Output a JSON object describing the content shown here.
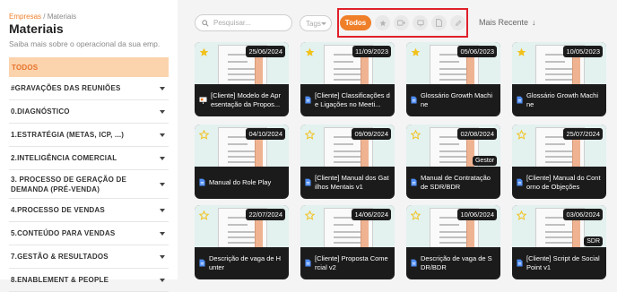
{
  "breadcrumb": {
    "parent": "Empresas",
    "separator": " / ",
    "current": "Materiais"
  },
  "page": {
    "title": "Materiais",
    "subtitle": "Saiba mais sobre o operacional da sua emp."
  },
  "sidebar": {
    "items": [
      {
        "label": "TODOS",
        "active": true
      },
      {
        "label": "#GRAVAÇÕES DAS REUNIÕES"
      },
      {
        "label": "0.DIAGNÓSTICO"
      },
      {
        "label": "1.ESTRATÉGIA (METAS, ICP, ...)"
      },
      {
        "label": "2.INTELIGÊNCIA COMERCIAL"
      },
      {
        "label": "3. PROCESSO DE GERAÇÃO DE DEMANDA (PRÉ-VENDA)"
      },
      {
        "label": "4.PROCESSO DE VENDAS"
      },
      {
        "label": "5.CONTEÚDO PARA VENDAS"
      },
      {
        "label": "7.GESTÃO & RESULTADOS"
      },
      {
        "label": "8.ENABLEMENT & PEOPLE"
      }
    ]
  },
  "toolbar": {
    "search_placeholder": "Pesquisar...",
    "tags_label": "Tags",
    "filter_all_label": "Todos",
    "sort_label": "Mais Recente",
    "highlight_color": "#e0202a",
    "accent_color": "#f07f2a"
  },
  "cards": [
    {
      "title": "[Cliente] Modelo de Apresentação da Propos...",
      "date": "25/06/2024",
      "starred": true,
      "icon": "presentation-icon"
    },
    {
      "title": "[Cliente] Classificações de Ligações no Meeti...",
      "date": "11/09/2023",
      "starred": true,
      "icon": "doc-icon"
    },
    {
      "title": "Glossário Growth Machine",
      "date": "05/06/2023",
      "starred": true,
      "icon": "doc-icon"
    },
    {
      "title": "Glossário Growth Machine",
      "date": "10/05/2023",
      "starred": true,
      "icon": "doc-icon"
    },
    {
      "title": "Manual do Role Play",
      "date": "04/10/2024",
      "starred": false,
      "icon": "doc-icon"
    },
    {
      "title": "[Cliente] Manual dos Gatilhos Mentais v1",
      "date": "09/09/2024",
      "starred": false,
      "icon": "doc-icon"
    },
    {
      "title": "Manual de Contratação de SDR/BDR",
      "date": "02/08/2024",
      "starred": false,
      "icon": "doc-icon",
      "badge": "Gestor"
    },
    {
      "title": "[Cliente] Manual do Contorno de Objeções",
      "date": "25/07/2024",
      "starred": false,
      "icon": "doc-icon"
    },
    {
      "title": "Descrição de vaga de Hunter",
      "date": "22/07/2024",
      "starred": false,
      "icon": "doc-icon"
    },
    {
      "title": "[Cliente] Proposta Comercial v2",
      "date": "14/06/2024",
      "starred": false,
      "icon": "doc-icon"
    },
    {
      "title": "Descrição de vaga de SDR/BDR",
      "date": "10/06/2024",
      "starred": false,
      "icon": "doc-icon"
    },
    {
      "title": "[Cliente] Script de Social Point v1",
      "date": "03/06/2024",
      "starred": false,
      "icon": "doc-icon",
      "badge": "SDR"
    }
  ]
}
